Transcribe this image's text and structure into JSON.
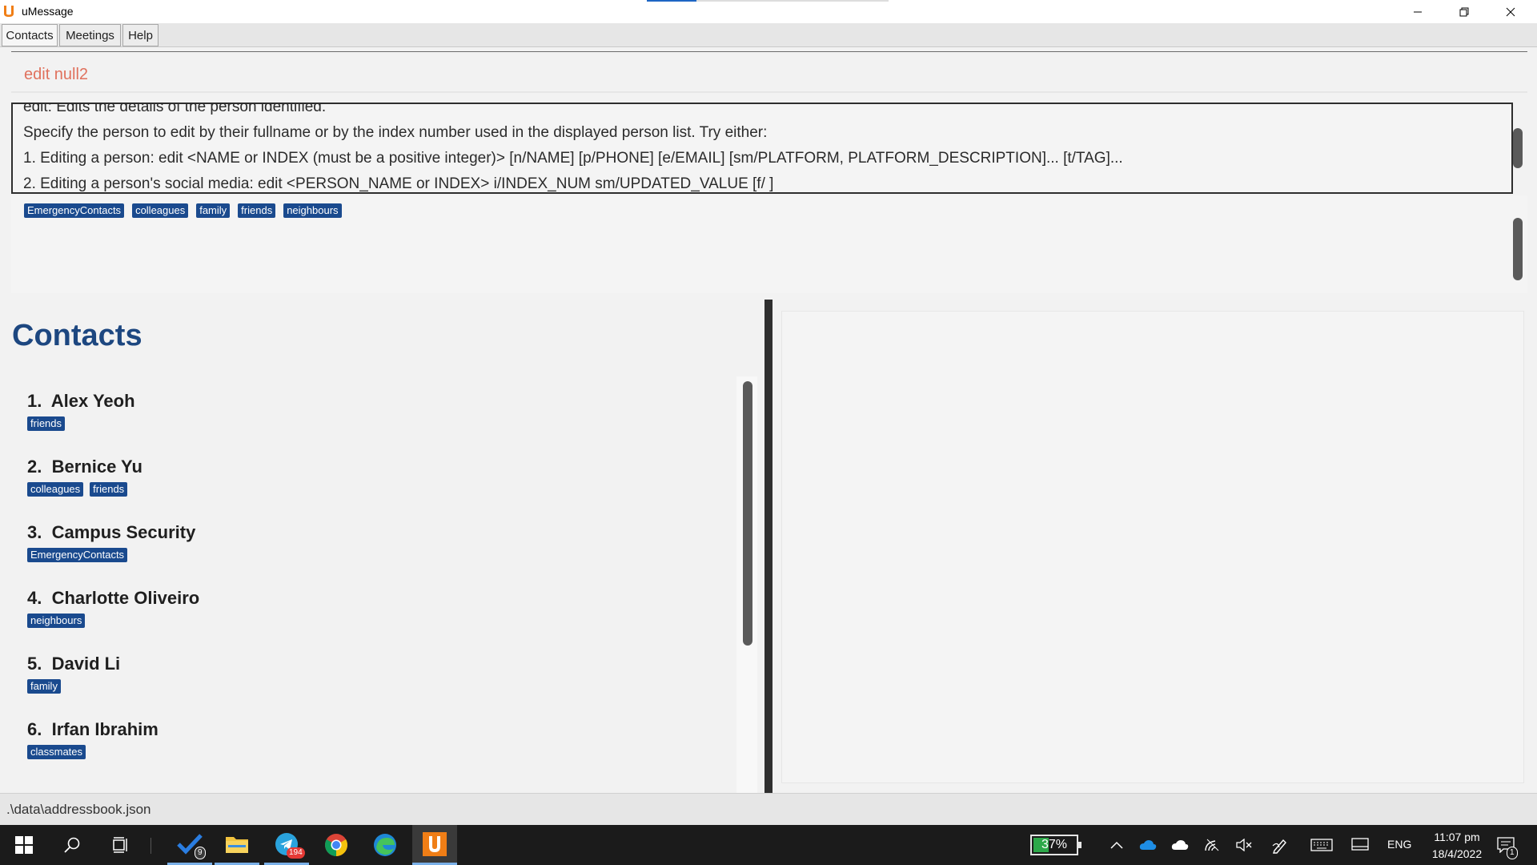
{
  "window": {
    "title": "uMessage",
    "logo_letter": "U"
  },
  "menu": {
    "contacts": "Contacts",
    "meetings": "Meetings",
    "help": "Help"
  },
  "command": {
    "text": "edit null2"
  },
  "result": {
    "lines": [
      "edit: Edits the details of the person identified.",
      "Specify the person to edit by their fullname or by the index number used in the displayed person list. Try either:",
      "1. Editing a person: edit <NAME or INDEX (must be a positive integer)> [n/NAME] [p/PHONE] [e/EMAIL] [sm/PLATFORM, PLATFORM_DESCRIPTION]... [t/TAG]...",
      "2. Editing a person's social media: edit <PERSON_NAME or INDEX> i/INDEX_NUM sm/UPDATED_VALUE [f/ ]"
    ]
  },
  "tag_panel": {
    "tags": [
      "EmergencyContacts",
      "colleagues",
      "family",
      "friends",
      "neighbours"
    ]
  },
  "contacts": {
    "title": "Contacts",
    "items": [
      {
        "index": "1.",
        "name": "Alex Yeoh",
        "tags": [
          "friends"
        ]
      },
      {
        "index": "2.",
        "name": "Bernice Yu",
        "tags": [
          "colleagues",
          "friends"
        ]
      },
      {
        "index": "3.",
        "name": "Campus Security",
        "tags": [
          "EmergencyContacts"
        ]
      },
      {
        "index": "4.",
        "name": "Charlotte Oliveiro",
        "tags": [
          "neighbours"
        ]
      },
      {
        "index": "5.",
        "name": "David Li",
        "tags": [
          "family"
        ]
      },
      {
        "index": "6.",
        "name": "Irfan Ibrahim",
        "tags": [
          "classmates"
        ]
      }
    ]
  },
  "status": {
    "path": ".\\data\\addressbook.json"
  },
  "taskbar": {
    "todo_badge": "9",
    "telegram_badge": "194",
    "battery": "37%",
    "battery_level": 0.37,
    "language": "ENG",
    "time": "11:07 pm",
    "date": "18/4/2022",
    "notification_count": "1"
  },
  "colors": {
    "accent": "#1d4780",
    "tag": "#1a4a8e",
    "command": "#e0715d"
  }
}
